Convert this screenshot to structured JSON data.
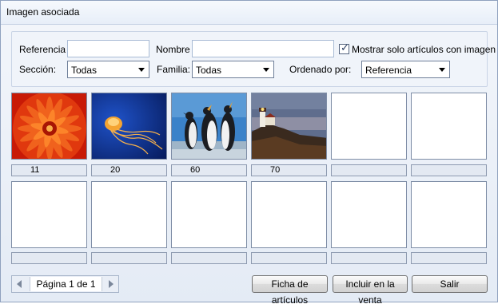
{
  "window": {
    "title": "Imagen asociada"
  },
  "filters": {
    "referencia_label": "Referencia",
    "referencia_value": "",
    "nombre_label": "Nombre",
    "nombre_value": "",
    "checkbox_label": "Mostrar solo artículos con imagen",
    "checkbox_checked": true,
    "seccion_label": "Sección:",
    "seccion_value": "Todas",
    "familia_label": "Familia:",
    "familia_value": "Todas",
    "ordenado_label": "Ordenado por:",
    "ordenado_value": "Referencia"
  },
  "tiles": [
    {
      "image": "red-flower",
      "label": "11"
    },
    {
      "image": "jellyfish",
      "label": "20"
    },
    {
      "image": "penguins",
      "label": "60"
    },
    {
      "image": "lighthouse",
      "label": "70"
    },
    {
      "image": "",
      "label": ""
    },
    {
      "image": "",
      "label": ""
    },
    {
      "image": "",
      "label": ""
    },
    {
      "image": "",
      "label": ""
    },
    {
      "image": "",
      "label": ""
    },
    {
      "image": "",
      "label": ""
    },
    {
      "image": "",
      "label": ""
    },
    {
      "image": "",
      "label": ""
    }
  ],
  "pager": {
    "text": "Página 1 de 1"
  },
  "buttons": {
    "ficha": "Ficha de artículos",
    "incluir": "Incluir en la venta",
    "salir": "Salir"
  },
  "colors": {
    "border": "#8fa1be",
    "panel": "#f0f4fa"
  }
}
